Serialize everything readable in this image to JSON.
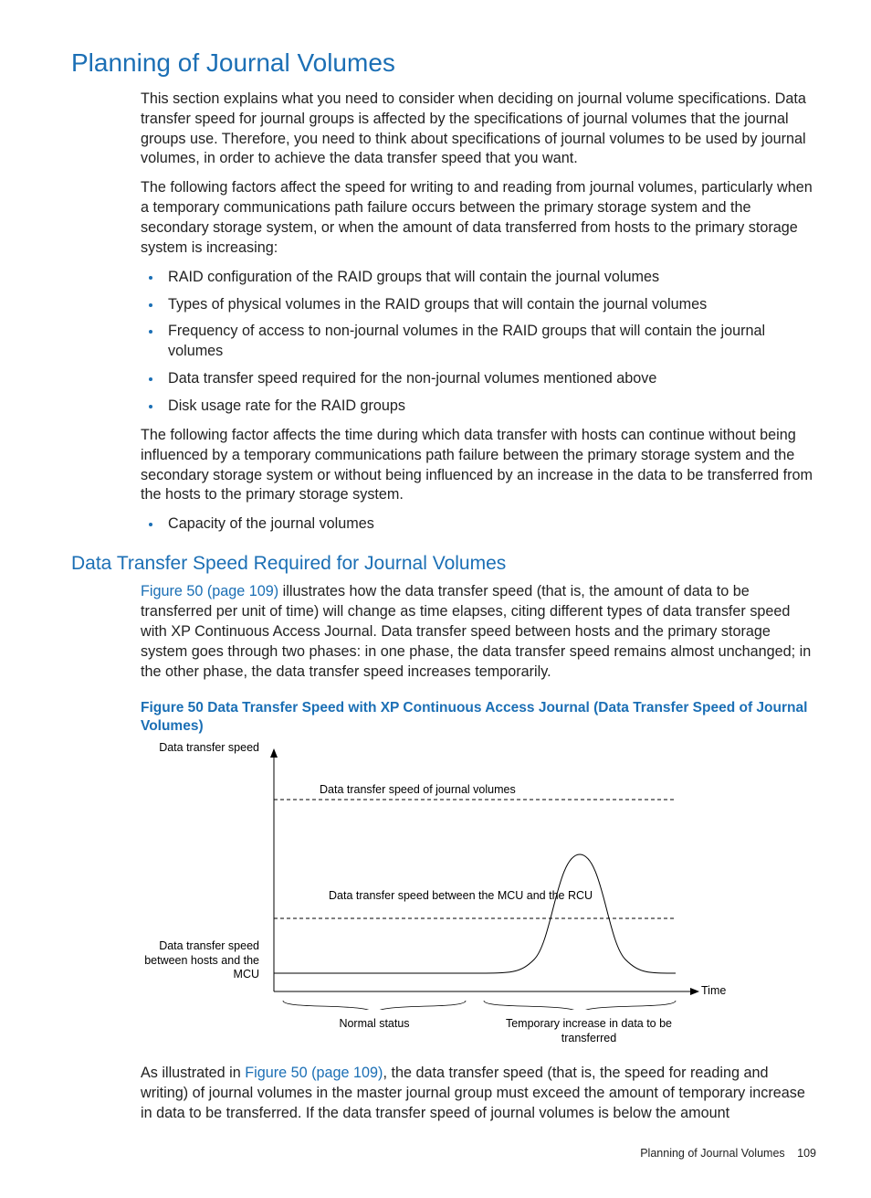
{
  "heading1": "Planning of Journal Volumes",
  "para1": "This section explains what you need to consider when deciding on journal volume specifications. Data transfer speed for journal groups is affected by the specifications of journal volumes that the journal groups use. Therefore, you need to think about specifications of journal volumes to be used by journal volumes, in order to achieve the data transfer speed that you want.",
  "para2": "The following factors affect the speed for writing to and reading from journal volumes, particularly when a temporary communications path failure occurs between the primary storage system and the secondary storage system, or when the amount of data transferred from hosts to the primary storage system is increasing:",
  "bullets1": [
    "RAID configuration of the RAID groups that will contain the journal volumes",
    "Types of physical volumes in the RAID groups that will contain the journal volumes",
    "Frequency of access to non-journal volumes in the RAID groups that will contain the journal volumes",
    "Data transfer speed required for the non-journal volumes mentioned above",
    "Disk usage rate for the RAID groups"
  ],
  "para3": "The following factor affects the time during which data transfer with hosts can continue without being influenced by a temporary communications path failure between the primary storage system and the secondary storage system or without being influenced by an increase in the data to be transferred from the hosts to the primary storage system.",
  "bullets2": [
    "Capacity of the journal volumes"
  ],
  "heading2": "Data Transfer Speed Required for Journal Volumes",
  "para4_link": "Figure 50 (page 109)",
  "para4_rest": " illustrates how the data transfer speed (that is, the amount of data to be transferred per unit of time) will change as time elapses, citing different types of data transfer speed with XP Continuous Access Journal. Data transfer speed between hosts and the primary storage system goes through two phases: in one phase, the data transfer speed remains almost unchanged; in the other phase, the data transfer speed increases temporarily.",
  "figure_caption": "Figure 50 Data Transfer Speed with XP Continuous Access Journal (Data Transfer Speed of Journal Volumes)",
  "chart_labels": {
    "y_top": "Data transfer speed",
    "y_side": "Data transfer speed between hosts and the MCU",
    "dash_upper": "Data transfer speed of journal volumes",
    "dash_lower": "Data transfer speed between the MCU and the RCU",
    "x_left": "Normal status",
    "x_right": "Temporary increase in data to be transferred",
    "x_axis": "Time"
  },
  "chart_data": {
    "type": "line",
    "title": "Data Transfer Speed with XP Continuous Access Journal",
    "xlabel": "Time",
    "ylabel": "Data transfer speed",
    "series": [
      {
        "name": "Data transfer speed of journal volumes",
        "style": "dashed-upper",
        "values_desc": "horizontal constant line near top"
      },
      {
        "name": "Data transfer speed between the MCU and the RCU",
        "style": "dashed-lower",
        "values_desc": "horizontal constant line mid"
      },
      {
        "name": "Data transfer speed between hosts and the MCU",
        "style": "solid",
        "values_desc": "flat baseline during Normal status, bell-shaped temporary peak during Temporary increase phase reaching between the two dashed lines"
      }
    ],
    "x_segments": [
      "Normal status",
      "Temporary increase in data to be transferred"
    ]
  },
  "para5_pre": "As illustrated in ",
  "para5_link": "Figure 50 (page 109)",
  "para5_rest": ", the data transfer speed (that is, the speed for reading and writing) of journal volumes in the master journal group must exceed the amount of temporary increase in data to be transferred. If the data transfer speed of journal volumes is below the amount",
  "footer_text": "Planning of Journal Volumes",
  "footer_page": "109"
}
